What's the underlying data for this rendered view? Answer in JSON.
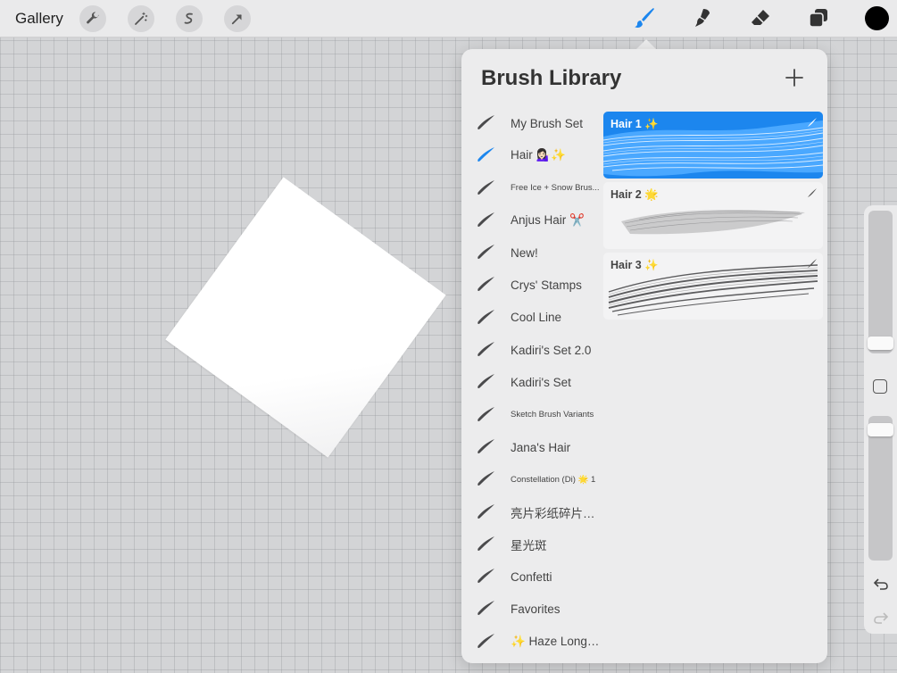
{
  "topbar": {
    "gallery_label": "Gallery",
    "left_tools": [
      "wrench-icon",
      "magic-wand-icon",
      "selection-icon",
      "transform-arrow-icon"
    ],
    "right_tools": [
      "brush-icon",
      "smudge-icon",
      "eraser-icon",
      "layers-icon"
    ],
    "active_tool": "brush-icon",
    "current_color": "#000000",
    "accent_color": "#1c86ee"
  },
  "brush_library": {
    "title": "Brush Library",
    "add_button": "plus-icon",
    "selected_set": "Hair 💁🏻‍♀️✨",
    "sets": [
      {
        "label": "My Brush Set",
        "small": false
      },
      {
        "label": "Hair 💁🏻‍♀️✨",
        "small": false,
        "active": true
      },
      {
        "label": "Free Ice + Snow Brus...",
        "small": true
      },
      {
        "label": "Anjus Hair ✂️",
        "small": false
      },
      {
        "label": "New!",
        "small": false
      },
      {
        "label": "Crys' Stamps",
        "small": false
      },
      {
        "label": "Cool Line",
        "small": false
      },
      {
        "label": "Kadiri's Set 2.0",
        "small": false
      },
      {
        "label": "Kadiri's Set",
        "small": false
      },
      {
        "label": "Sketch Brush Variants",
        "small": true
      },
      {
        "label": "Jana's Hair",
        "small": false
      },
      {
        "label": "Constellation (Di) 🌟 1",
        "small": true
      },
      {
        "label": "亮片彩纸碎片颗粒",
        "small": false
      },
      {
        "label": "星光斑",
        "small": false
      },
      {
        "label": "Confetti",
        "small": false
      },
      {
        "label": "Favorites",
        "small": false
      },
      {
        "label": "✨ Haze Long ✨",
        "small": false
      }
    ],
    "brushes": [
      {
        "name": "Hair 1 ✨",
        "selected": true
      },
      {
        "name": "Hair 2 🌟",
        "selected": false
      },
      {
        "name": "Hair 3 ✨",
        "selected": false
      }
    ]
  },
  "sidebar": {
    "brush_size": 0.58,
    "opacity": 0.52,
    "undo": "undo-icon",
    "redo": "redo-icon"
  }
}
